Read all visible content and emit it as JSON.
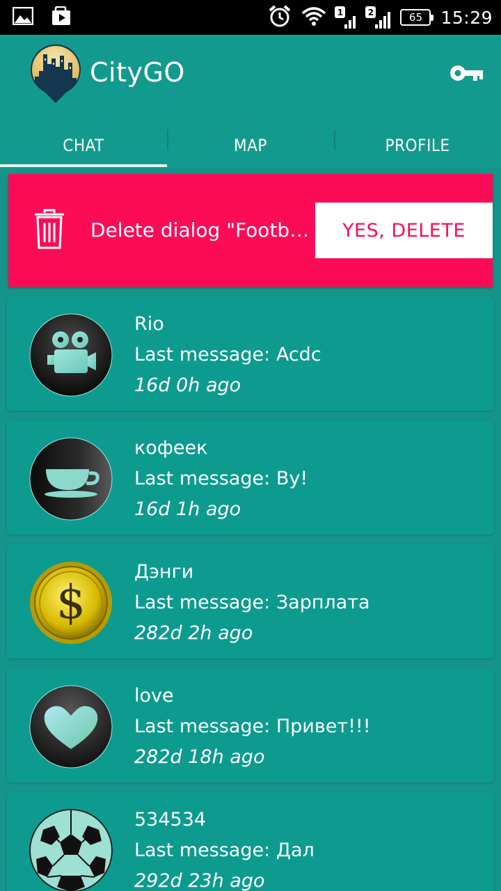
{
  "status_bar": {
    "time": "15:29",
    "battery": "65",
    "sim1": "1",
    "sim2": "2",
    "icons": [
      "image-icon",
      "play-store-icon",
      "alarm-icon",
      "wifi-icon",
      "signal-icon"
    ]
  },
  "app": {
    "title": "CityGO",
    "logo_icon": "city-pin-logo",
    "action_icon": "key-icon"
  },
  "tabs": [
    {
      "label": "CHAT",
      "active": true
    },
    {
      "label": "MAP",
      "active": false
    },
    {
      "label": "PROFILE",
      "active": false
    }
  ],
  "delete_prompt": {
    "icon": "trash-icon",
    "text": "Delete dialog \"Football...",
    "confirm_label": "YES, DELETE"
  },
  "chats": [
    {
      "name": "Rio",
      "last_message": "Last message: Acdc",
      "time": "16d 0h ago",
      "avatar": "movie-camera-icon"
    },
    {
      "name": "кофеек",
      "last_message": "Last message: By!",
      "time": "16d 1h ago",
      "avatar": "coffee-cup-icon"
    },
    {
      "name": "Дэнги",
      "last_message": "Last message: Зарплата",
      "time": "282d 2h ago",
      "avatar": "dollar-coin-icon"
    },
    {
      "name": "love",
      "last_message": "Last message: Привет!!!",
      "time": "282d 18h ago",
      "avatar": "heart-icon"
    },
    {
      "name": "534534",
      "last_message": "Last message: Дал",
      "time": "292d 23h ago",
      "avatar": "soccer-ball-icon"
    }
  ],
  "colors": {
    "primary": "#139a8e",
    "card": "#0d9b8f",
    "delete": "#fc0c56",
    "status_bar": "#000000"
  }
}
